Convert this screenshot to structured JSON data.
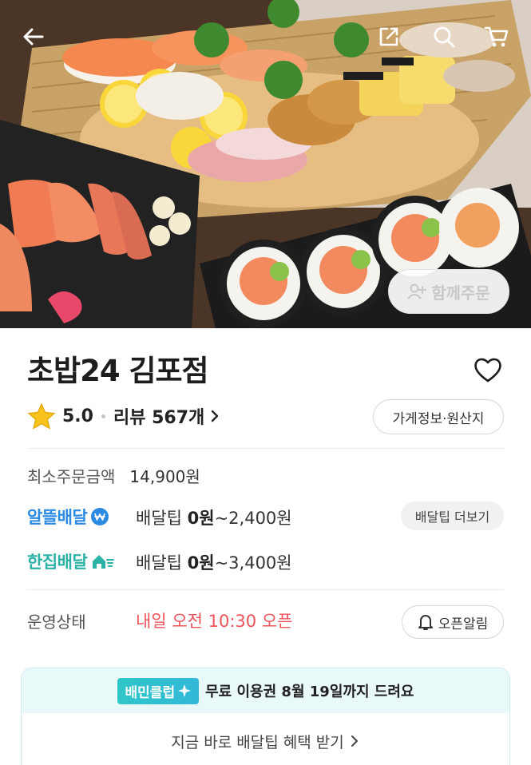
{
  "hero": {
    "together_label": "함께주문",
    "icons": [
      "back-arrow-icon",
      "share-icon",
      "search-icon",
      "cart-icon",
      "add-person-icon"
    ]
  },
  "store": {
    "name": "초밥24 김포점",
    "rating": "5.0",
    "review_label": "리뷰 567개",
    "info_button": "가게정보·원산지"
  },
  "order": {
    "min_label": "최소주문금액",
    "min_value": "14,900원"
  },
  "delivery": [
    {
      "brand": "알뜰배달",
      "tip_prefix": "배달팁 ",
      "tip_bold": "0원",
      "tip_rest": "~2,400원",
      "color": "#2b8ae2"
    },
    {
      "brand": "한집배달",
      "tip_prefix": "배달팁 ",
      "tip_bold": "0원",
      "tip_rest": "~3,400원",
      "color": "#2bb1a6"
    }
  ],
  "more_tips_button": "배달팁 더보기",
  "status": {
    "label": "운영상태",
    "value": "내일 오전 10:30 오픈",
    "value_color": "#f0525a",
    "alarm_button": "오픈알림"
  },
  "club": {
    "badge": "배민클럽",
    "text": "무료 이용권 8월 19일까지 드려요",
    "link": "지금 바로 배달팁 혜택 받기"
  },
  "colors": {
    "star": "#f7c21d",
    "club_accent": "#2fc6c8"
  }
}
